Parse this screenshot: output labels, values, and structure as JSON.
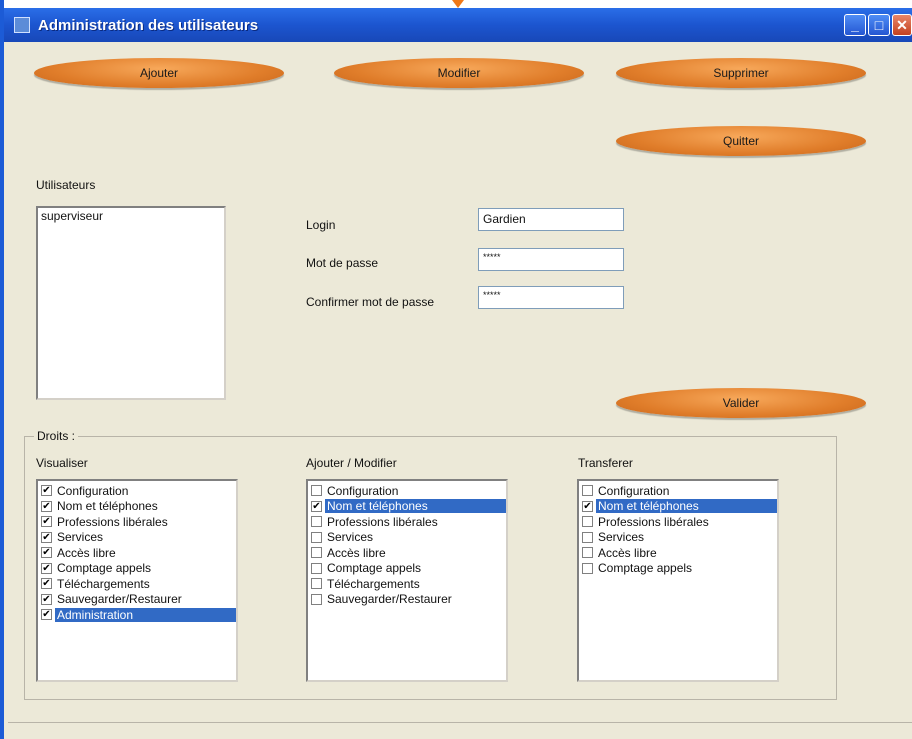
{
  "window": {
    "title": "Administration des utilisateurs",
    "buttons": [
      "minimize-icon",
      "maximize-icon",
      "close-icon"
    ]
  },
  "actions": {
    "add": "Ajouter",
    "modify": "Modifier",
    "delete": "Supprimer",
    "quit": "Quitter",
    "validate": "Valider"
  },
  "users": {
    "label": "Utilisateurs",
    "items": [
      "superviseur"
    ]
  },
  "form": {
    "login_label": "Login",
    "login_value": "Gardien",
    "password_label": "Mot de passe",
    "password_value": "*****",
    "confirm_label": "Confirmer mot de passe",
    "confirm_value": "*****"
  },
  "rights": {
    "legend": "Droits :",
    "groups": [
      {
        "title": "Visualiser",
        "items": [
          {
            "label": "Configuration",
            "checked": true,
            "selected": false
          },
          {
            "label": "Nom et téléphones",
            "checked": true,
            "selected": false
          },
          {
            "label": "Professions libérales",
            "checked": true,
            "selected": false
          },
          {
            "label": "Services",
            "checked": true,
            "selected": false
          },
          {
            "label": "Accès libre",
            "checked": true,
            "selected": false
          },
          {
            "label": "Comptage appels",
            "checked": true,
            "selected": false
          },
          {
            "label": "Téléchargements",
            "checked": true,
            "selected": false
          },
          {
            "label": "Sauvegarder/Restaurer",
            "checked": true,
            "selected": false
          },
          {
            "label": "Administration",
            "checked": true,
            "selected": true
          }
        ]
      },
      {
        "title": "Ajouter / Modifier",
        "items": [
          {
            "label": "Configuration",
            "checked": false,
            "selected": false
          },
          {
            "label": "Nom et téléphones",
            "checked": true,
            "selected": true
          },
          {
            "label": "Professions libérales",
            "checked": false,
            "selected": false
          },
          {
            "label": "Services",
            "checked": false,
            "selected": false
          },
          {
            "label": "Accès libre",
            "checked": false,
            "selected": false
          },
          {
            "label": "Comptage appels",
            "checked": false,
            "selected": false
          },
          {
            "label": "Téléchargements",
            "checked": false,
            "selected": false
          },
          {
            "label": "Sauvegarder/Restaurer",
            "checked": false,
            "selected": false
          }
        ]
      },
      {
        "title": "Transferer",
        "items": [
          {
            "label": "Configuration",
            "checked": false,
            "selected": false
          },
          {
            "label": "Nom et téléphones",
            "checked": true,
            "selected": true
          },
          {
            "label": "Professions libérales",
            "checked": false,
            "selected": false
          },
          {
            "label": "Services",
            "checked": false,
            "selected": false
          },
          {
            "label": "Accès libre",
            "checked": false,
            "selected": false
          },
          {
            "label": "Comptage appels",
            "checked": false,
            "selected": false
          }
        ]
      }
    ]
  },
  "colors": {
    "button_orange": "#e07d2a",
    "selection": "#316ac5",
    "titlebar": "#1c55cf"
  }
}
